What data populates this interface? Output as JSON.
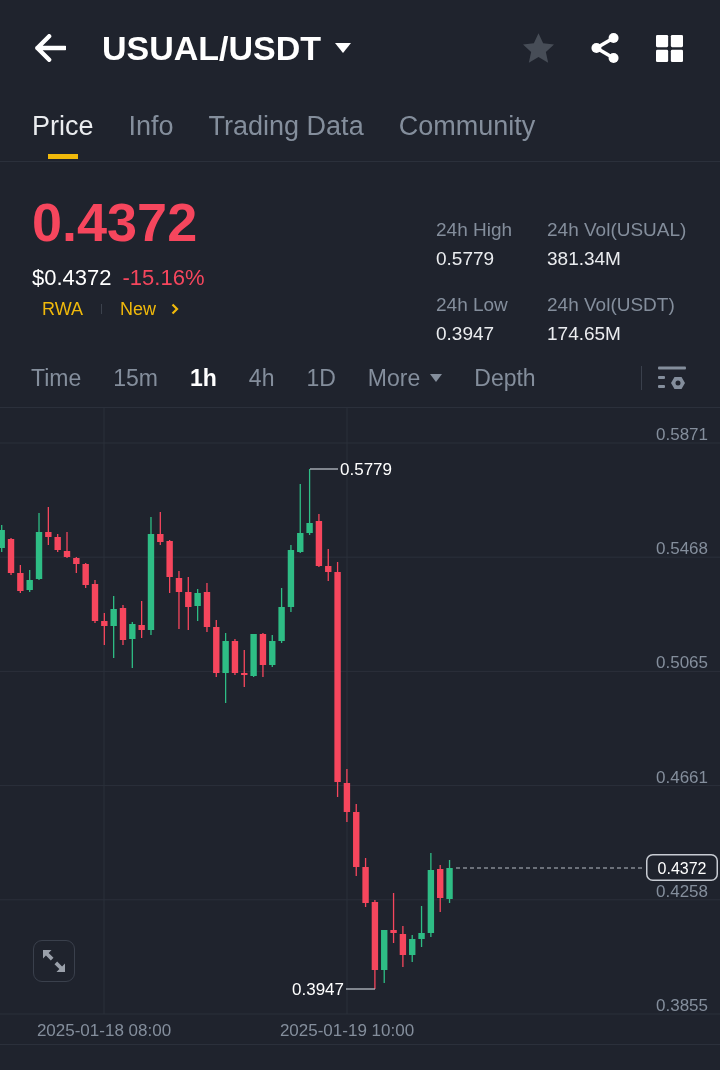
{
  "header": {
    "title": "USUAL/USDT",
    "favorited": false
  },
  "tabs": [
    {
      "label": "Price",
      "selected": true
    },
    {
      "label": "Info",
      "selected": false
    },
    {
      "label": "Trading Data",
      "selected": false
    },
    {
      "label": "Community",
      "selected": false
    }
  ],
  "price": {
    "last": "0.4372",
    "falling": true,
    "usd": "$0.4372",
    "change": "-15.16%",
    "tags": [
      {
        "label": "RWA",
        "kind": "tag"
      },
      {
        "label": "New",
        "kind": "link"
      }
    ]
  },
  "stats": [
    {
      "label": "24h High",
      "value": "0.5779"
    },
    {
      "label": "24h Vol(USUAL)",
      "value": "381.34M"
    },
    {
      "label": "24h Low",
      "value": "0.3947"
    },
    {
      "label": "24h Vol(USDT)",
      "value": "174.65M"
    }
  ],
  "intervals": [
    {
      "label": "Time",
      "kind": "interval",
      "selected": false
    },
    {
      "label": "15m",
      "kind": "interval",
      "selected": false
    },
    {
      "label": "1h",
      "kind": "interval",
      "selected": true
    },
    {
      "label": "4h",
      "kind": "interval",
      "selected": false
    },
    {
      "label": "1D",
      "kind": "interval",
      "selected": false
    },
    {
      "label": "More",
      "kind": "menu",
      "selected": false
    },
    {
      "label": "Depth",
      "kind": "interval",
      "selected": false
    }
  ],
  "chart": {
    "y_axis_labels": [
      "0.5871",
      "0.5468",
      "0.5065",
      "0.4661",
      "0.4258",
      "0.3855"
    ],
    "x_axis_labels": [
      "2025-01-18 08:00",
      "2025-01-19 10:00"
    ],
    "high_label": "0.5779",
    "low_label": "0.3947",
    "last_price_label": "0.4372"
  }
}
